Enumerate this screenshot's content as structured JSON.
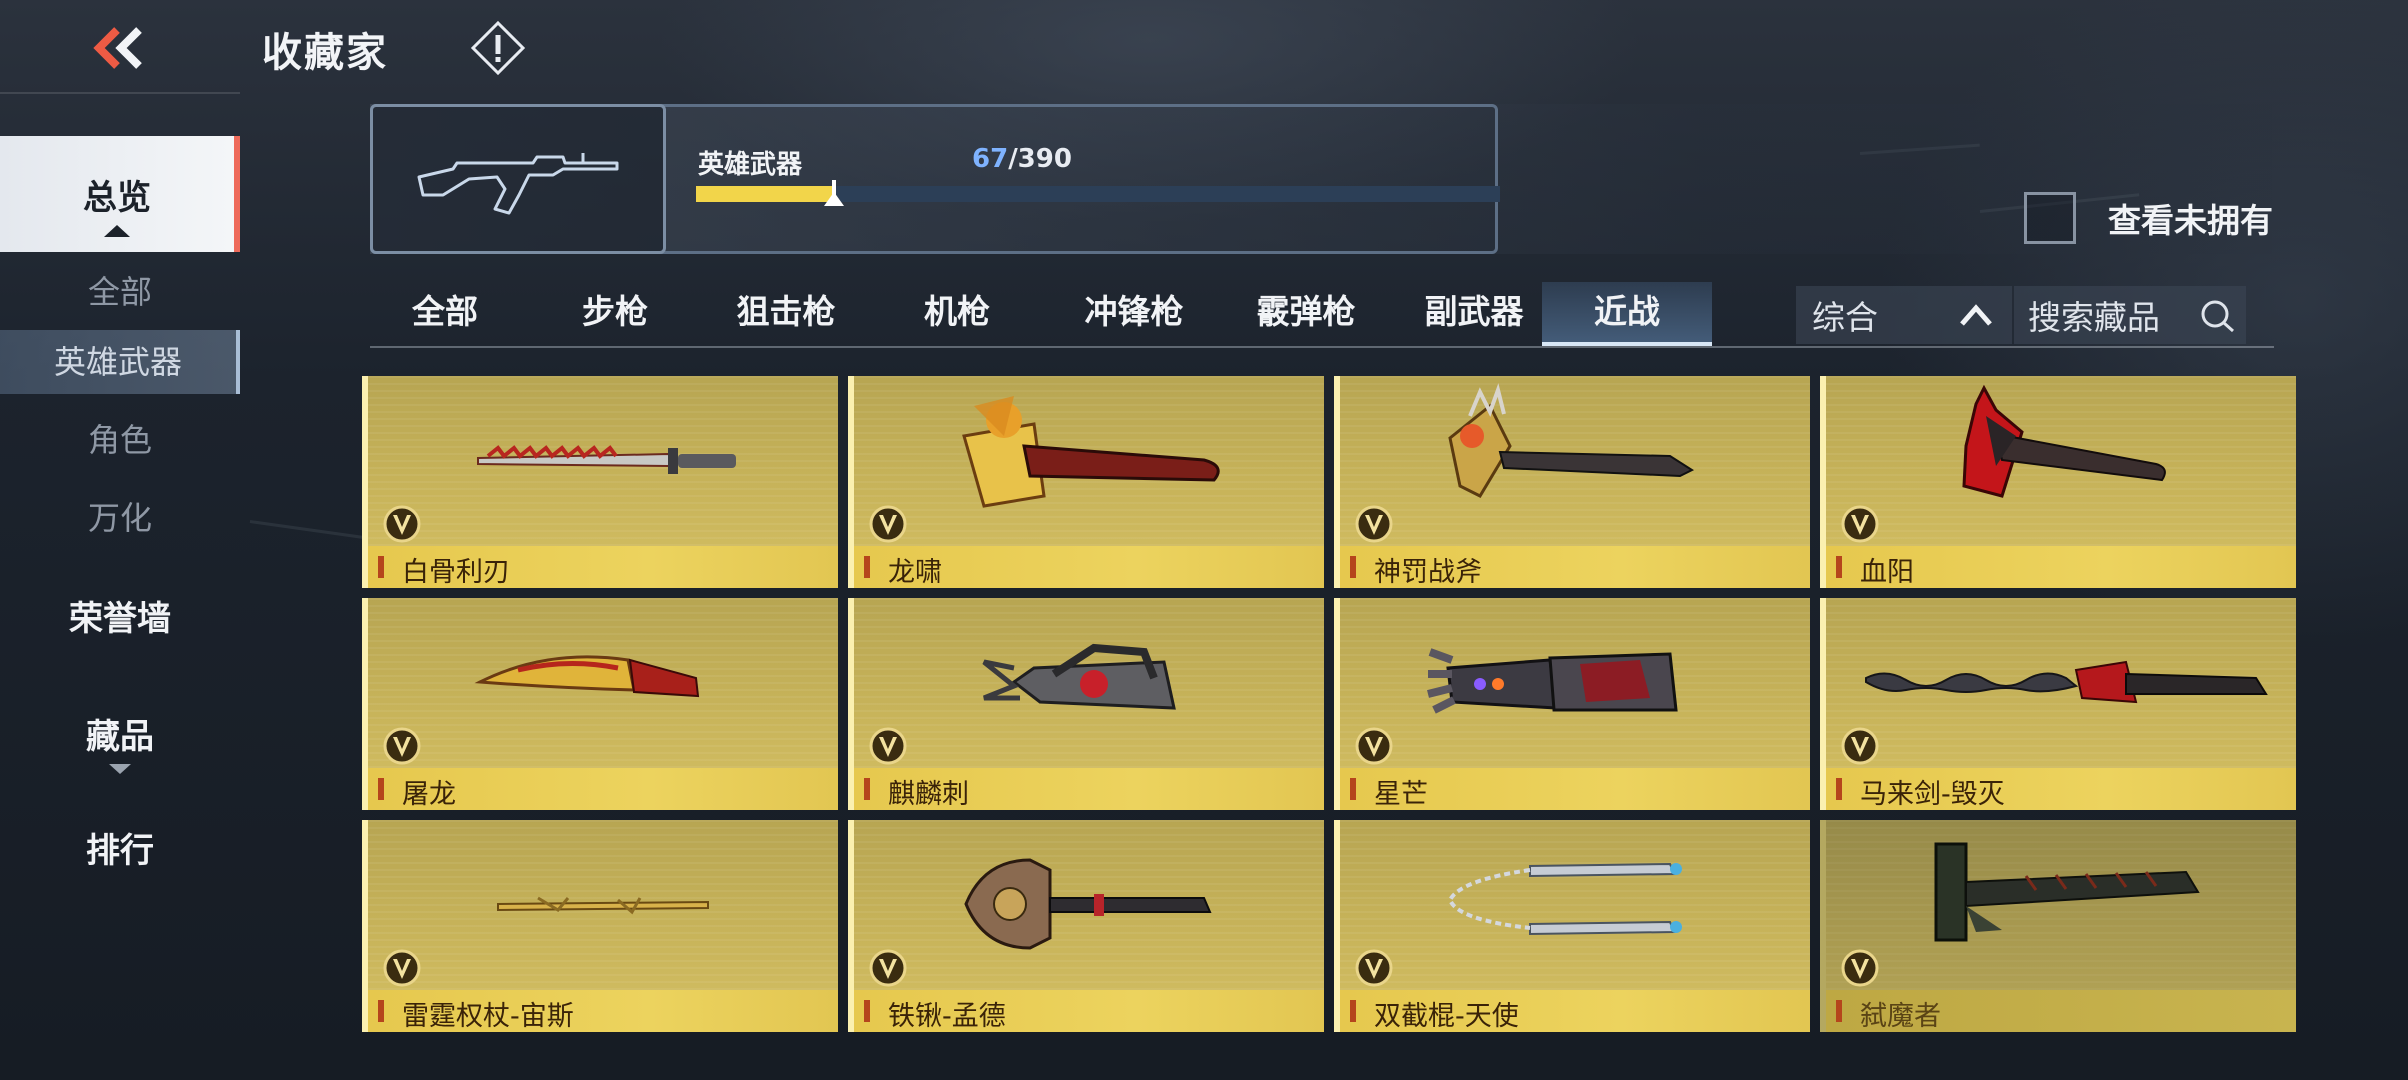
{
  "header": {
    "title": "收藏家"
  },
  "sidebar": {
    "overview": "总览",
    "sub_items": [
      {
        "label": "全部"
      },
      {
        "label": "英雄武器"
      },
      {
        "label": "角色"
      },
      {
        "label": "万化"
      }
    ],
    "honor_wall": "荣誉墙",
    "collection": "藏品",
    "ranking": "排行",
    "active_sub": "英雄武器"
  },
  "progress": {
    "label": "英雄武器",
    "current": "67",
    "separator_total": "/390",
    "ratio": 0.172
  },
  "filter": {
    "unowned_label": "查看未拥有",
    "unowned_checked": false,
    "sort_label": "综合",
    "search_placeholder": "搜索藏品"
  },
  "tabs": [
    {
      "label": "全部"
    },
    {
      "label": "步枪"
    },
    {
      "label": "狙击枪"
    },
    {
      "label": "机枪"
    },
    {
      "label": "冲锋枪"
    },
    {
      "label": "霰弹枪"
    },
    {
      "label": "副武器"
    },
    {
      "label": "近战"
    }
  ],
  "active_tab": "近战",
  "items": [
    {
      "name": "白骨利刃",
      "weapon_icon": "bone-knife-icon",
      "owned": true
    },
    {
      "name": "龙啸",
      "weapon_icon": "golden-axe-icon",
      "owned": true
    },
    {
      "name": "神罚战斧",
      "weapon_icon": "battle-axe-icon",
      "owned": true
    },
    {
      "name": "血阳",
      "weapon_icon": "red-axe-icon",
      "owned": true
    },
    {
      "name": "屠龙",
      "weapon_icon": "kukri-icon",
      "owned": true
    },
    {
      "name": "麒麟刺",
      "weapon_icon": "claw-blade-icon",
      "owned": true
    },
    {
      "name": "星芒",
      "weapon_icon": "gauntlet-icon",
      "owned": true
    },
    {
      "name": "马来剑-毁灭",
      "weapon_icon": "kris-sword-icon",
      "owned": true
    },
    {
      "name": "雷霆权杖-宙斯",
      "weapon_icon": "scepter-icon",
      "owned": true
    },
    {
      "name": "铁锹-孟德",
      "weapon_icon": "shovel-icon",
      "owned": true
    },
    {
      "name": "双截棍-天使",
      "weapon_icon": "nunchaku-icon",
      "owned": true
    },
    {
      "name": "弑魔者",
      "weapon_icon": "demon-blade-icon",
      "owned": false
    }
  ],
  "colors": {
    "accent_gold": "#f2d54a",
    "progress_track": "#2c3f57",
    "count_current": "#7fb3ff",
    "card_gold": "#c8b45a",
    "sidebar_active_edge": "#ee6a5a"
  }
}
